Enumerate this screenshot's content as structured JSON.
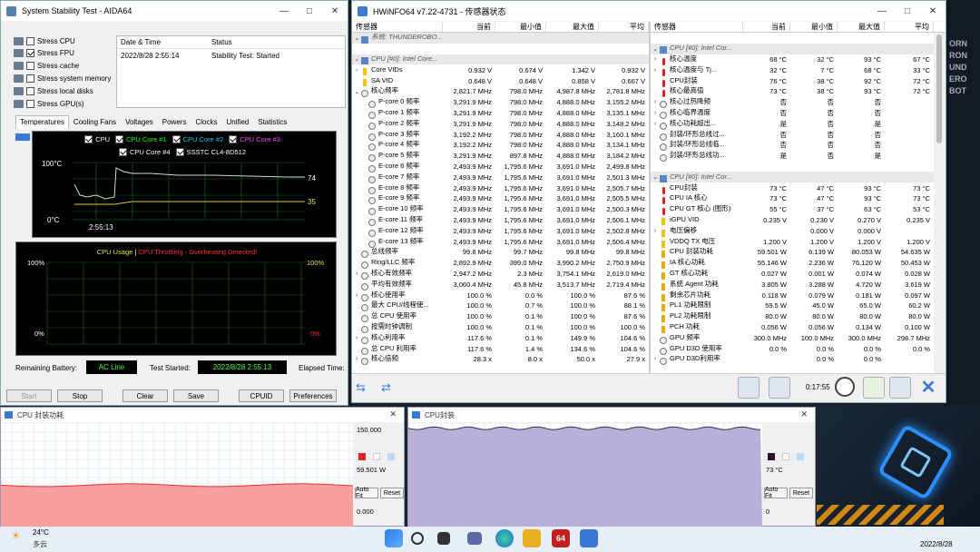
{
  "aida": {
    "title": "System Stability Test - AIDA64",
    "stress_items": [
      {
        "label": "Stress CPU",
        "checked": false,
        "icon": "cpu-chip-icon"
      },
      {
        "label": "Stress FPU",
        "checked": true,
        "icon": "fpu-icon"
      },
      {
        "label": "Stress cache",
        "checked": false,
        "icon": "cache-icon"
      },
      {
        "label": "Stress system memory",
        "checked": false,
        "icon": "memory-icon"
      },
      {
        "label": "Stress local disks",
        "checked": false,
        "icon": "disk-icon"
      },
      {
        "label": "Stress GPU(s)",
        "checked": false,
        "icon": "gpu-icon"
      }
    ],
    "status_table": {
      "col_date": "Date & Time",
      "col_status": "Status",
      "date": "2022/8/28 2:55:14",
      "status": "Stability Test: Started"
    },
    "tabs": [
      "Temperatures",
      "Cooling Fans",
      "Voltages",
      "Powers",
      "Clocks",
      "Unified",
      "Statistics"
    ],
    "active_tab": "Temperatures",
    "legend": [
      {
        "label": "CPU",
        "color": "#ffffff"
      },
      {
        "label": "CPU Core #1",
        "color": "#00ff00"
      },
      {
        "label": "CPU Core #2",
        "color": "#00ccff"
      },
      {
        "label": "CPU Core #3",
        "color": "#ff44ff"
      },
      {
        "label": "CPU Core #4",
        "color": "#ffffff"
      },
      {
        "label": "SSSTC CL4-8D512",
        "color": "#ffffff"
      }
    ],
    "temp_axis_top": "100°C",
    "temp_axis_bottom": "0°C",
    "temp_time": "2:55:13",
    "temp_values": [
      "74",
      "35"
    ],
    "usage_label": "CPU Usage",
    "usage_sep": "|",
    "throttle_label": "CPU Throttling - Overheating Detected!",
    "usage_left_top": "100%",
    "usage_left_bottom": "0%",
    "usage_right_top": "100%",
    "usage_right_bottom": "0%",
    "remaining_label": "Remaining Battery:",
    "remaining_value": "AC Line",
    "started_label": "Test Started:",
    "started_value": "2022/8/28 2:55:13",
    "elapsed_label": "Elapsed Time:",
    "buttons": {
      "start": "Start",
      "stop": "Stop",
      "clear": "Clear",
      "save": "Save",
      "cpuid": "CPUID",
      "prefs": "Preferences"
    }
  },
  "hw": {
    "title": "HWiNFO64 v7.22-4731 - 传感器状态",
    "cols": [
      "传感器",
      "当前",
      "最小值",
      "最大值",
      "平均"
    ],
    "left_rows": [
      {
        "k": "g",
        "name": "系统: THUNDEROBO...",
        "c": "",
        "mn": "",
        "mx": "",
        "av": ""
      },
      {
        "k": "b",
        "name": "",
        "c": "",
        "mn": "",
        "mx": "",
        "av": ""
      },
      {
        "k": "g",
        "name": "CPU [#0]: Intel Core...",
        "c": "",
        "mn": "",
        "mx": "",
        "av": ""
      },
      {
        "k": "v",
        "a": ">",
        "name": "Core VIDs",
        "c": "0.932 V",
        "mn": "0.674 V",
        "mx": "1.342 V",
        "av": "0.932 V"
      },
      {
        "k": "v",
        "a": "",
        "name": "SA VID",
        "c": "0.648 V",
        "mn": "0.648 V",
        "mx": "0.858 V",
        "av": "0.667 V"
      },
      {
        "k": "c",
        "a": "v",
        "name": "核心频率",
        "c": "2,821.7 MHz",
        "mn": "798.0 MHz",
        "mx": "4,987.8 MHz",
        "av": "2,781.8 MHz"
      },
      {
        "k": "c",
        "i": 1,
        "name": "P-core 0 频率",
        "c": "3,291.9 MHz",
        "mn": "798.0 MHz",
        "mx": "4,888.0 MHz",
        "av": "3,155.2 MHz"
      },
      {
        "k": "c",
        "i": 1,
        "name": "P-core 1 频率",
        "c": "3,291.9 MHz",
        "mn": "798.0 MHz",
        "mx": "4,888.0 MHz",
        "av": "3,135.1 MHz"
      },
      {
        "k": "c",
        "i": 1,
        "name": "P-core 2 频率",
        "c": "3,291.9 MHz",
        "mn": "798.0 MHz",
        "mx": "4,888.0 MHz",
        "av": "3,148.2 MHz"
      },
      {
        "k": "c",
        "i": 1,
        "name": "P-core 3 频率",
        "c": "3,192.2 MHz",
        "mn": "798.0 MHz",
        "mx": "4,888.0 MHz",
        "av": "3,160.1 MHz"
      },
      {
        "k": "c",
        "i": 1,
        "name": "P-core 4 频率",
        "c": "3,192.2 MHz",
        "mn": "798.0 MHz",
        "mx": "4,888.0 MHz",
        "av": "3,134.1 MHz"
      },
      {
        "k": "c",
        "i": 1,
        "name": "P-core 5 频率",
        "c": "3,291.9 MHz",
        "mn": "897.8 MHz",
        "mx": "4,888.0 MHz",
        "av": "3,184.2 MHz"
      },
      {
        "k": "c",
        "i": 1,
        "name": "E-core 6 频率",
        "c": "2,493.9 MHz",
        "mn": "1,795.6 MHz",
        "mx": "3,691.0 MHz",
        "av": "2,499.8 MHz"
      },
      {
        "k": "c",
        "i": 1,
        "name": "E-core 7 频率",
        "c": "2,493.9 MHz",
        "mn": "1,795.6 MHz",
        "mx": "3,691.0 MHz",
        "av": "2,501.3 MHz"
      },
      {
        "k": "c",
        "i": 1,
        "name": "E-core 8 频率",
        "c": "2,493.9 MHz",
        "mn": "1,795.6 MHz",
        "mx": "3,691.0 MHz",
        "av": "2,505.7 MHz"
      },
      {
        "k": "c",
        "i": 1,
        "name": "E-core 9 频率",
        "c": "2,493.9 MHz",
        "mn": "1,795.6 MHz",
        "mx": "3,691.0 MHz",
        "av": "2,505.5 MHz"
      },
      {
        "k": "c",
        "i": 1,
        "name": "E-core 10 频率",
        "c": "2,493.9 MHz",
        "mn": "1,795.6 MHz",
        "mx": "3,691.0 MHz",
        "av": "2,500.3 MHz"
      },
      {
        "k": "c",
        "i": 1,
        "name": "E-core 11 频率",
        "c": "2,493.9 MHz",
        "mn": "1,795.6 MHz",
        "mx": "3,691.0 MHz",
        "av": "2,506.1 MHz"
      },
      {
        "k": "c",
        "i": 1,
        "name": "E-core 12 频率",
        "c": "2,493.9 MHz",
        "mn": "1,795.6 MHz",
        "mx": "3,691.0 MHz",
        "av": "2,502.8 MHz"
      },
      {
        "k": "c",
        "i": 1,
        "name": "E-core 13 频率",
        "c": "2,493.9 MHz",
        "mn": "1,795.6 MHz",
        "mx": "3,691.0 MHz",
        "av": "2,506.4 MHz"
      },
      {
        "k": "c",
        "a": "",
        "name": "总线频率",
        "c": "99.8 MHz",
        "mn": "99.7 MHz",
        "mx": "99.8 MHz",
        "av": "99.8 MHz"
      },
      {
        "k": "c",
        "a": "",
        "name": "Ring/LLC 频率",
        "c": "2,892.9 MHz",
        "mn": "399.0 MHz",
        "mx": "3,990.2 MHz",
        "av": "2,750.9 MHz"
      },
      {
        "k": "c",
        "a": ">",
        "name": "核心有效频率",
        "c": "2,947.2 MHz",
        "mn": "2.3 MHz",
        "mx": "3,754.1 MHz",
        "av": "2,619.0 MHz"
      },
      {
        "k": "c",
        "a": "",
        "name": "平均有效频率",
        "c": "3,060.4 MHz",
        "mn": "45.8 MHz",
        "mx": "3,513.7 MHz",
        "av": "2,719.4 MHz"
      },
      {
        "k": "c",
        "a": ">",
        "name": "核心使用率",
        "c": "100.0 %",
        "mn": "0.0 %",
        "mx": "100.0 %",
        "av": "87.6 %"
      },
      {
        "k": "c",
        "a": "",
        "name": "最大 CPU/线程使...",
        "c": "100.0 %",
        "mn": "0.7 %",
        "mx": "100.0 %",
        "av": "88.1 %"
      },
      {
        "k": "c",
        "a": "",
        "name": "总 CPU 使用率",
        "c": "100.0 %",
        "mn": "0.1 %",
        "mx": "100.0 %",
        "av": "87.6 %"
      },
      {
        "k": "c",
        "a": "",
        "name": "按需时钟调制",
        "c": "100.0 %",
        "mn": "0.1 %",
        "mx": "100.0 %",
        "av": "100.0 %"
      },
      {
        "k": "c",
        "a": ">",
        "name": "核心利用率",
        "c": "117.6 %",
        "mn": "0.1 %",
        "mx": "149.9 %",
        "av": "104.6 %"
      },
      {
        "k": "c",
        "a": "",
        "name": "总 CPU 利用率",
        "c": "117.6 %",
        "mn": "1.4 %",
        "mx": "134.6 %",
        "av": "104.6 %"
      },
      {
        "k": "c",
        "a": ">",
        "name": "核心倍频",
        "c": "28.3 x",
        "mn": "8.0 x",
        "mx": "50.0 x",
        "av": "27.9 x"
      }
    ],
    "right_rows": [
      {
        "k": "b",
        "name": "",
        "c": "",
        "mn": "",
        "mx": "",
        "av": ""
      },
      {
        "k": "g",
        "name": "CPU [#0]: Intel Cor...",
        "c": "",
        "mn": "",
        "mx": "",
        "av": ""
      },
      {
        "k": "t",
        "a": ">",
        "name": "核心温度",
        "c": "68 °C",
        "mn": "32 °C",
        "mx": "93 °C",
        "av": "67 °C"
      },
      {
        "k": "t",
        "a": ">",
        "name": "核心温度与 Tj...",
        "c": "32 °C",
        "mn": "7 °C",
        "mx": "68 °C",
        "av": "33 °C"
      },
      {
        "k": "t",
        "a": "",
        "name": "CPU封装",
        "c": "76 °C",
        "mn": "38 °C",
        "mx": "92 °C",
        "av": "72 °C"
      },
      {
        "k": "t",
        "a": "",
        "name": "核心最高值",
        "c": "73 °C",
        "mn": "38 °C",
        "mx": "93 °C",
        "av": "72 °C"
      },
      {
        "k": "c",
        "a": ">",
        "name": "核心过热降频",
        "c": "否",
        "mn": "否",
        "mx": "否",
        "av": ""
      },
      {
        "k": "c",
        "a": ">",
        "name": "核心临界温度",
        "c": "否",
        "mn": "否",
        "mx": "否",
        "av": ""
      },
      {
        "k": "c",
        "a": ">",
        "name": "核心功耗超出...",
        "c": "是",
        "mn": "否",
        "mx": "是",
        "av": ""
      },
      {
        "k": "c",
        "a": "",
        "name": "封装/环形总线过...",
        "c": "否",
        "mn": "否",
        "mx": "否",
        "av": ""
      },
      {
        "k": "c",
        "a": "",
        "name": "封装/环形总线临...",
        "c": "否",
        "mn": "否",
        "mx": "否",
        "av": ""
      },
      {
        "k": "c",
        "a": "",
        "name": "封装/环形总线功...",
        "c": "是",
        "mn": "否",
        "mx": "是",
        "av": ""
      },
      {
        "k": "b",
        "name": "",
        "c": "",
        "mn": "",
        "mx": "",
        "av": ""
      },
      {
        "k": "g",
        "name": "CPU [#0]: Intel Cor...",
        "c": "",
        "mn": "",
        "mx": "",
        "av": ""
      },
      {
        "k": "t",
        "a": "",
        "name": "CPU封装",
        "c": "73 °C",
        "mn": "47 °C",
        "mx": "93 °C",
        "av": "73 °C"
      },
      {
        "k": "t",
        "a": "",
        "name": "CPU IA 核心",
        "c": "73 °C",
        "mn": "47 °C",
        "mx": "93 °C",
        "av": "73 °C"
      },
      {
        "k": "t",
        "a": "",
        "name": "CPU GT 核心 (图形)",
        "c": "55 °C",
        "mn": "37 °C",
        "mx": "63 °C",
        "av": "53 °C"
      },
      {
        "k": "v",
        "a": "",
        "name": "iGPU VID",
        "c": "0.235 V",
        "mn": "0.230 V",
        "mx": "0.270 V",
        "av": "0.235 V"
      },
      {
        "k": "v",
        "a": ">",
        "name": "电压偏移",
        "c": "",
        "mn": "0.000 V",
        "mx": "0.000 V",
        "av": ""
      },
      {
        "k": "v",
        "a": "",
        "name": "VDDQ TX 电压",
        "c": "1.200 V",
        "mn": "1.200 V",
        "mx": "1.200 V",
        "av": "1.200 V"
      },
      {
        "k": "p",
        "a": "",
        "name": "CPU 封装功耗",
        "c": "59.501 W",
        "mn": "6.139 W",
        "mx": "80.053 W",
        "av": "54.635 W"
      },
      {
        "k": "p",
        "a": "",
        "name": "IA 核心功耗",
        "c": "55.146 W",
        "mn": "2.236 W",
        "mx": "76.120 W",
        "av": "50.453 W"
      },
      {
        "k": "p",
        "a": "",
        "name": "GT 核心功耗",
        "c": "0.027 W",
        "mn": "0.001 W",
        "mx": "0.074 W",
        "av": "0.028 W"
      },
      {
        "k": "p",
        "a": "",
        "name": "系统 Agent 功耗",
        "c": "3.805 W",
        "mn": "3.288 W",
        "mx": "4.720 W",
        "av": "3.619 W"
      },
      {
        "k": "p",
        "a": "",
        "name": "剩余芯片功耗",
        "c": "0.118 W",
        "mn": "0.079 W",
        "mx": "0.181 W",
        "av": "0.097 W"
      },
      {
        "k": "p",
        "a": "",
        "name": "PL1 功耗限制",
        "c": "59.5 W",
        "mn": "45.0 W",
        "mx": "65.0 W",
        "av": "60.2 W"
      },
      {
        "k": "p",
        "a": "",
        "name": "PL2 功耗限制",
        "c": "80.0 W",
        "mn": "80.0 W",
        "mx": "80.0 W",
        "av": "80.0 W"
      },
      {
        "k": "p",
        "a": "",
        "name": "PCH 功耗",
        "c": "0.056 W",
        "mn": "0.056 W",
        "mx": "0.134 W",
        "av": "0.100 W"
      },
      {
        "k": "c",
        "a": "",
        "name": "GPU 频率",
        "c": "300.0 MHz",
        "mn": "100.0 MHz",
        "mx": "300.0 MHz",
        "av": "298.7 MHz"
      },
      {
        "k": "c",
        "a": "",
        "name": "GPU D3D 使用率",
        "c": "0.0 %",
        "mn": "0.0 %",
        "mx": "0.0 %",
        "av": "0.0 %"
      },
      {
        "k": "c",
        "a": ">",
        "name": "GPU D3D利用率",
        "c": "",
        "mn": "0.0 %",
        "mx": "0.0 %",
        "av": ""
      }
    ],
    "elapsed": "0:17:55"
  },
  "power_graph": {
    "title": "CPU 封装功耗",
    "max": "150.000",
    "current": "59.501 W",
    "min": "0.000",
    "autofit": "Auto Fit",
    "reset": "Reset",
    "fill_level": 0.4,
    "fill_color": "#f8a0a0",
    "line_color": "#e03030"
  },
  "temp_graph": {
    "title": "CPU封装",
    "current": "73 °C",
    "min": "0",
    "autofit": "Auto Fit",
    "reset": "Reset",
    "fill_level": 0.95,
    "fill_color": "#b8b0d8",
    "line_color": "#303050"
  },
  "taskbar": {
    "weather_temp": "24°C",
    "weather_desc": "多云",
    "date": "2022/8/28"
  },
  "wallpaper_text": "ORN\nRON\nUND\nERO\nBOT"
}
